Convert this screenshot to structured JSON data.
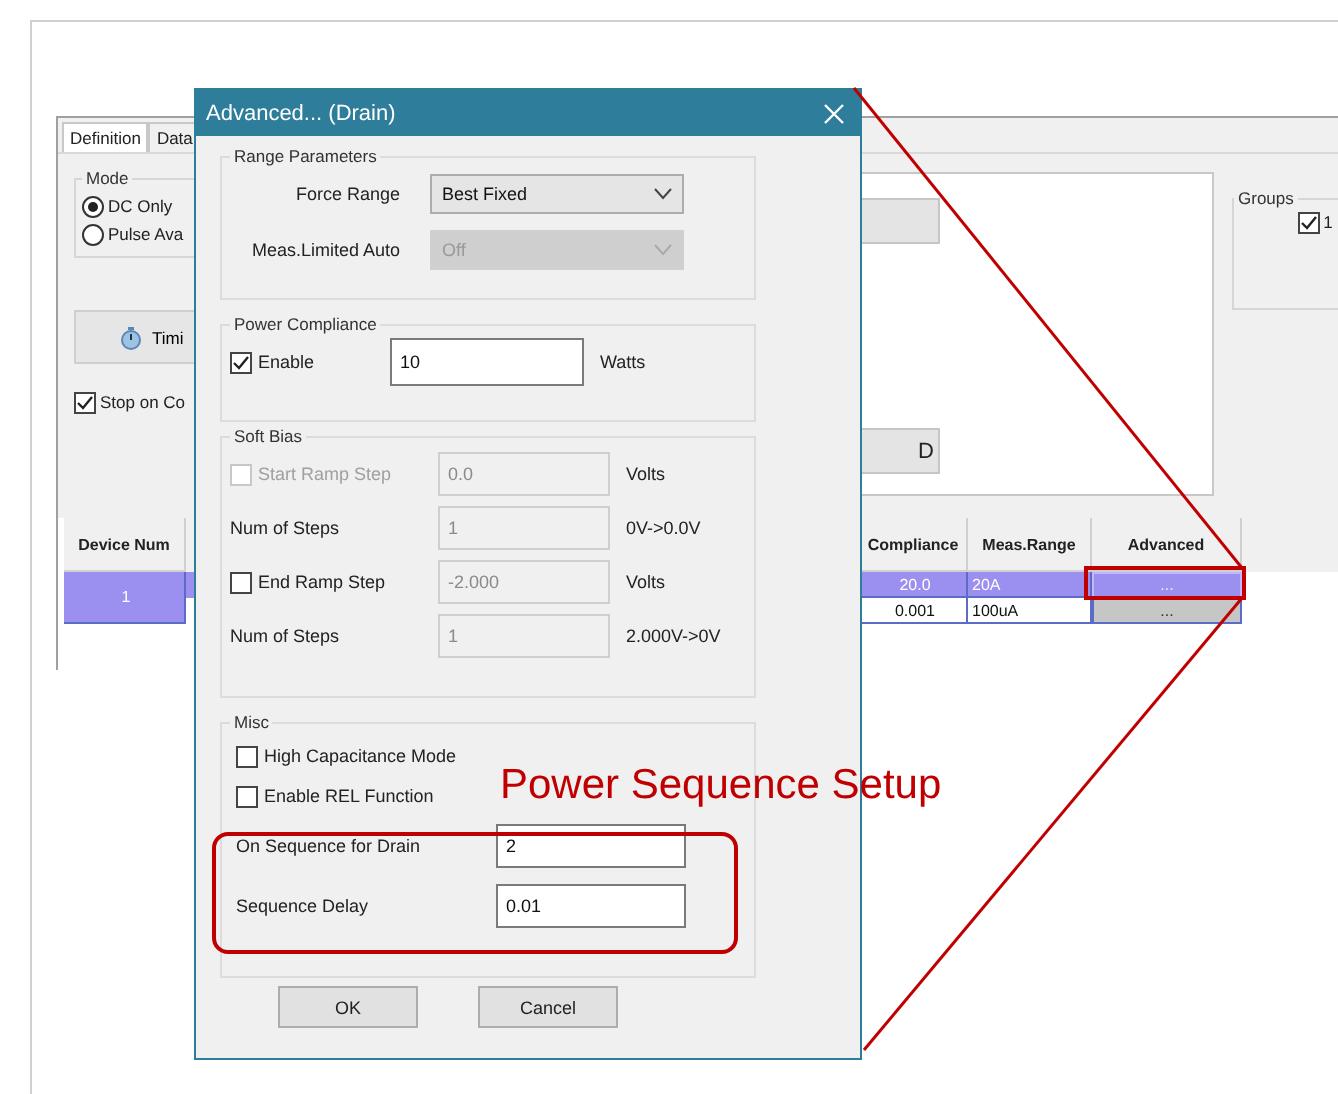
{
  "background_window": {
    "tabs": [
      {
        "label": "Definition",
        "selected": true
      },
      {
        "label": "Data",
        "selected": false
      }
    ],
    "mode_group": {
      "title": "Mode",
      "options": [
        {
          "label": "DC Only",
          "selected": true
        },
        {
          "label": "Pulse Ava",
          "selected": false
        }
      ]
    },
    "timing_button": {
      "label": "Timi"
    },
    "stop_checkbox": {
      "label": "Stop on Co",
      "checked": true
    },
    "side_button": {
      "label": "D"
    },
    "groups": {
      "title": "Groups",
      "items": [
        {
          "label": "1",
          "checked": true
        }
      ]
    },
    "table": {
      "columns": [
        "Device Num",
        "Compliance",
        "Meas.Range",
        "Advanced"
      ],
      "rows": [
        {
          "device": "1",
          "lines": [
            {
              "selected": true,
              "compliance": "20.0",
              "meas_range": "20A",
              "advanced": "..."
            },
            {
              "selected": false,
              "compliance": "0.001",
              "meas_range": "100uA",
              "advanced": "..."
            }
          ]
        }
      ]
    }
  },
  "dialog": {
    "title": "Advanced... (Drain)",
    "groups": [
      {
        "title": "Range Parameters",
        "rows": [
          {
            "kind": "select",
            "label": "Force Range",
            "value": "Best Fixed",
            "disabled": false
          },
          {
            "kind": "select",
            "label": "Meas.Limited Auto",
            "value": "Off",
            "disabled": true
          }
        ]
      },
      {
        "title": "Power Compliance",
        "rows": [
          {
            "kind": "check_input",
            "label": "Enable",
            "checked": true,
            "disabled": false,
            "value": "10",
            "input_disabled": false,
            "unit": "Watts"
          }
        ]
      },
      {
        "title": "Soft Bias",
        "rows": [
          {
            "kind": "check_input",
            "label": "Start Ramp Step",
            "checked": false,
            "disabled": true,
            "value": "0.0",
            "input_disabled": true,
            "unit": "Volts"
          },
          {
            "kind": "input",
            "label": "Num of Steps",
            "value": "1",
            "disabled": true,
            "unit": "0V->0.0V"
          },
          {
            "kind": "check_input",
            "label": "End Ramp Step",
            "checked": false,
            "disabled": false,
            "value": "-2.000",
            "input_disabled": true,
            "unit": "Volts"
          },
          {
            "kind": "input",
            "label": "Num of Steps",
            "value": "1",
            "disabled": true,
            "unit": "2.000V->0V"
          }
        ]
      },
      {
        "title": "Misc",
        "rows": [
          {
            "kind": "checkbox",
            "label": "High Capacitance Mode",
            "checked": false
          },
          {
            "kind": "checkbox",
            "label": "Enable REL Function",
            "checked": false
          },
          {
            "kind": "input",
            "label": "On Sequence for Drain",
            "value": "2",
            "disabled": false
          },
          {
            "kind": "input",
            "label": "Sequence Delay",
            "value": "0.01",
            "disabled": false
          }
        ]
      }
    ],
    "buttons": [
      "OK",
      "Cancel"
    ]
  },
  "annotation": {
    "text": "Power Sequence Setup"
  }
}
